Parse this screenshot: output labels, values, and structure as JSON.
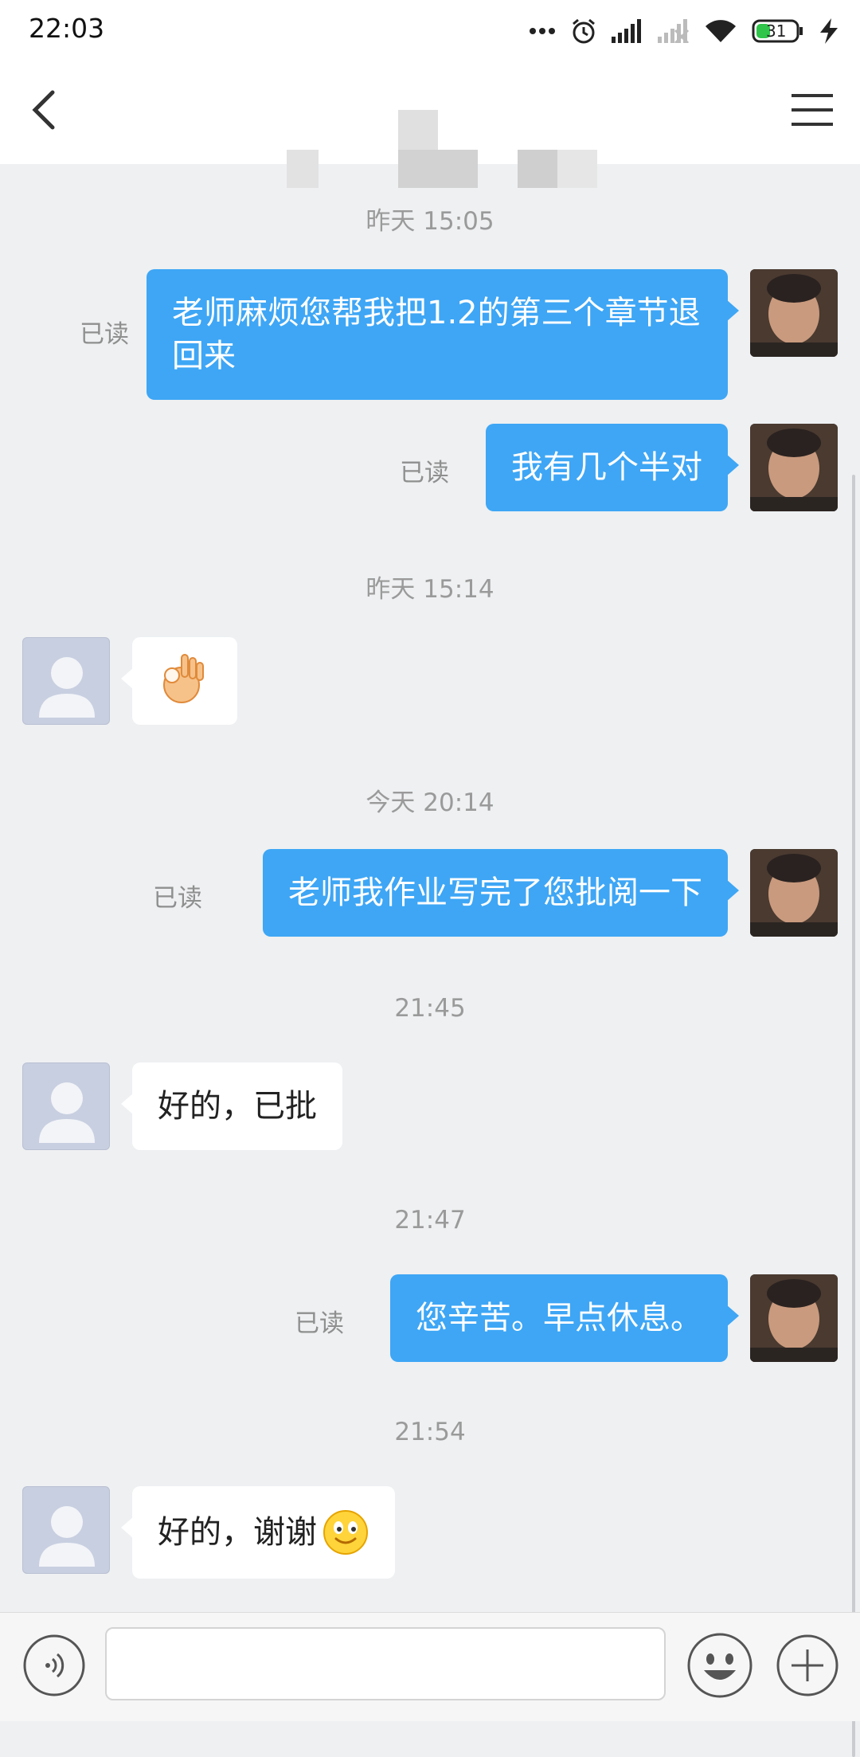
{
  "status_bar": {
    "time": "22:03",
    "battery_level": "31",
    "icons": [
      "more-dots-icon",
      "alarm-icon",
      "signal-icon",
      "signal-weak-icon",
      "wifi-icon",
      "battery-icon",
      "charging-icon"
    ]
  },
  "nav": {
    "back_icon": "chevron-left-icon",
    "menu_icon": "hamburger-menu-icon"
  },
  "messages": [
    {
      "type": "timestamp",
      "text": "昨天 15:05"
    },
    {
      "type": "sent",
      "text": "老师麻烦您帮我把1.2的第三个章节退回来",
      "status": "已读"
    },
    {
      "type": "sent",
      "text": "我有几个半对",
      "status": "已读"
    },
    {
      "type": "timestamp",
      "text": "昨天 15:14"
    },
    {
      "type": "received",
      "emoji": "ok-hand-emoji"
    },
    {
      "type": "timestamp",
      "text": "今天 20:14"
    },
    {
      "type": "sent",
      "text": "老师我作业写完了您批阅一下",
      "status": "已读"
    },
    {
      "type": "timestamp",
      "text": "21:45"
    },
    {
      "type": "received",
      "text": "好的，已批"
    },
    {
      "type": "timestamp",
      "text": "21:47"
    },
    {
      "type": "sent",
      "text": "您辛苦。早点休息。",
      "status": "已读"
    },
    {
      "type": "timestamp",
      "text": "21:54"
    },
    {
      "type": "received",
      "text": "好的，谢谢",
      "emoji": "smile-emoji"
    }
  ],
  "input_bar": {
    "placeholder": "",
    "icons": [
      "voice-icon",
      "emoji-icon",
      "plus-icon"
    ]
  },
  "colors": {
    "sent_bubble": "#3ea6f5",
    "received_bubble": "#ffffff",
    "chat_background": "#eef0f2"
  }
}
